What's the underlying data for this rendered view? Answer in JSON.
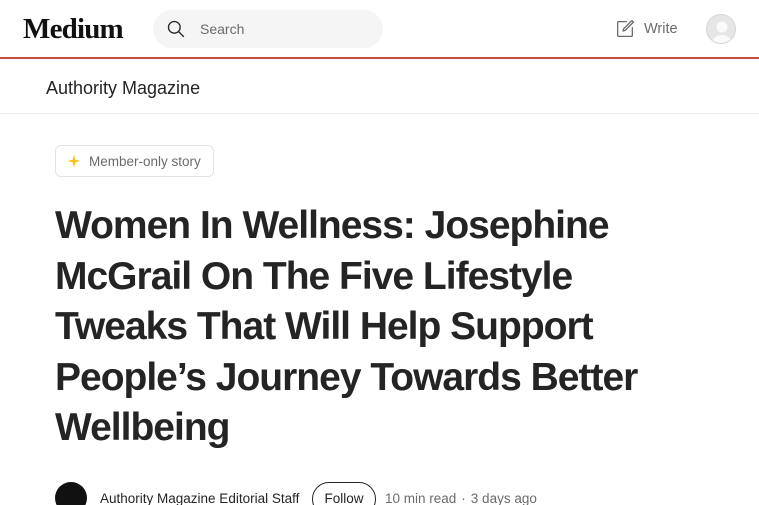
{
  "header": {
    "logo_text": "Medium",
    "search": {
      "placeholder": "Search",
      "icon": "search-icon"
    },
    "write_label": "Write",
    "write_icon": "write-icon",
    "accent_line_color": "#c94a3f"
  },
  "publication": {
    "name": "Authority Magazine"
  },
  "article": {
    "member_badge": {
      "label": "Member-only story",
      "icon": "star-icon",
      "icon_color": "#ffc017"
    },
    "title": "Women In Wellness: Josephine McGrail On The Five Lifestyle Tweaks That Will Help Support People’s Journey Towards Better Wellbeing",
    "byline": {
      "author": "Authority Magazine Editorial Staff",
      "follow_label": "Follow",
      "read_time": "10 min read",
      "separator": "·",
      "published": "3 days ago"
    }
  }
}
